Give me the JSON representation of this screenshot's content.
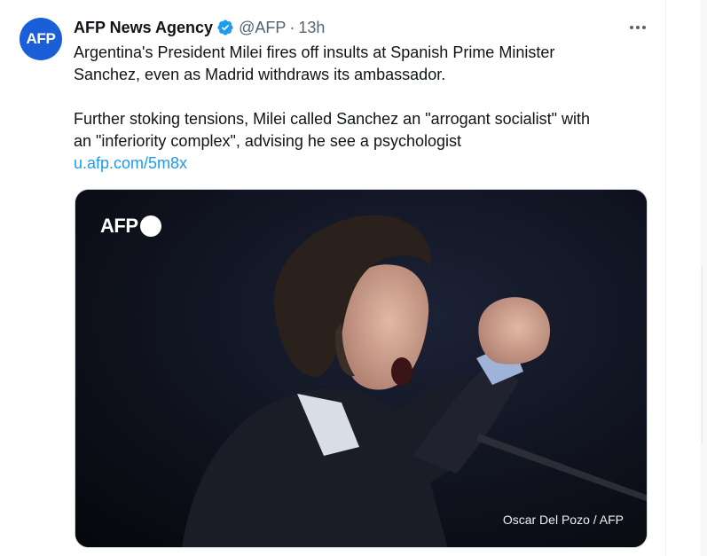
{
  "tweet": {
    "avatar_text": "AFP",
    "display_name": "AFP News Agency",
    "verified_icon": "verified-badge-icon",
    "handle": "@AFP",
    "separator": "·",
    "time": "13h",
    "more_icon": "more-horizontal-icon",
    "text_lines": [
      "Argentina's President Milei fires off insults at Spanish Prime Minister",
      "Sanchez, even as Madrid withdraws its ambassador.",
      "Further stoking tensions, Milei called Sanchez an \"arrogant socialist\" with",
      "an \"inferiority complex\", advising he see a psychologist"
    ],
    "link": "u.afp.com/5m8x",
    "media": {
      "watermark": "AFP",
      "credit": "Oscar Del Pozo / AFP"
    }
  },
  "colors": {
    "brand_blue": "#1b5fd8",
    "link_blue": "#1d9bf0",
    "verified_blue": "#1d9bf0",
    "secondary_text": "#536471"
  }
}
